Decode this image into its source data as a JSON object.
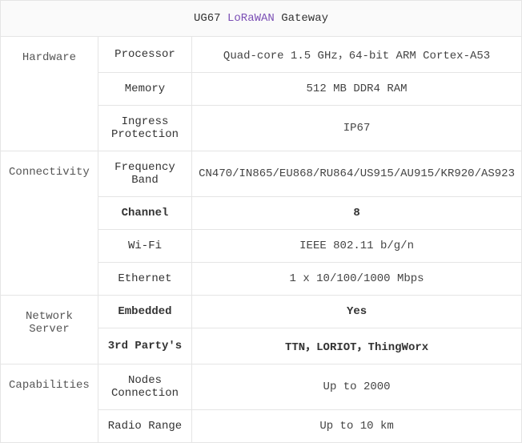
{
  "title": {
    "prefix": "UG67 ",
    "link": "LoRaWAN",
    "suffix": " Gateway"
  },
  "sections": [
    {
      "name": "Hardware",
      "rows": [
        {
          "label": "Processor",
          "value": "Quad-core 1.5 GHz，64-bit ARM  Cortex-A53",
          "bold": false
        },
        {
          "label": "Memory",
          "value": "512 MB DDR4 RAM",
          "bold": false
        },
        {
          "label": "Ingress Protection",
          "value": "IP67",
          "bold": false
        }
      ]
    },
    {
      "name": "Connectivity",
      "rows": [
        {
          "label": "Frequency Band",
          "value": "CN470/IN865/EU868/RU864/US915/AU915/KR920/AS923",
          "bold": false
        },
        {
          "label": "Channel",
          "value": "8",
          "bold": true
        },
        {
          "label": "Wi-Fi",
          "value": "IEEE 802.11 b/g/n",
          "bold": false
        },
        {
          "label": "Ethernet",
          "value": "1 x 10/100/1000 Mbps",
          "bold": false
        }
      ]
    },
    {
      "name": "Network Server",
      "rows": [
        {
          "label": "Embedded",
          "value": "Yes",
          "bold": true
        },
        {
          "label": "3rd Party's",
          "value": "TTN，LORIOT，ThingWorx",
          "bold": true
        }
      ]
    },
    {
      "name": "Capabilities",
      "rows": [
        {
          "label": "Nodes Connection",
          "value": "Up to 2000",
          "bold": false
        },
        {
          "label": "Radio Range",
          "value": "Up to 10 km",
          "bold": false
        }
      ]
    }
  ]
}
